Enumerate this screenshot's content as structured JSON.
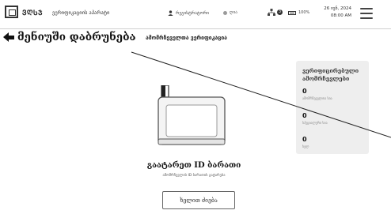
{
  "header": {
    "logo_text": "ᲕᲦᲡᲯ",
    "app_title": "ვერიფიკაციის აპარატი",
    "user_name": "რეგისტრატორი",
    "status_text": "ღია",
    "network_count": "3",
    "battery_text": "100%",
    "date": "26 ივნ, 2024",
    "time": "08:00 AM"
  },
  "nav": {
    "back_label": "მენიუში დაბრუნება",
    "page_title": "ამომრჩეველთა ვერიფიკაცია"
  },
  "sidebar": {
    "title": "ვერიფიცირებული ამომრჩევლები",
    "stats": [
      {
        "value": "0",
        "label": "ამომრჩეველთა სია"
      },
      {
        "value": "0",
        "label": "სპეციალური სია"
      },
      {
        "value": "0",
        "label": "ხელ"
      }
    ]
  },
  "main": {
    "prompt": "გაატარეთ ID ბარათი",
    "subprompt": "ამომრჩევლის ID ბარათის გატარება",
    "manual_button": "ხელით ძიება"
  }
}
